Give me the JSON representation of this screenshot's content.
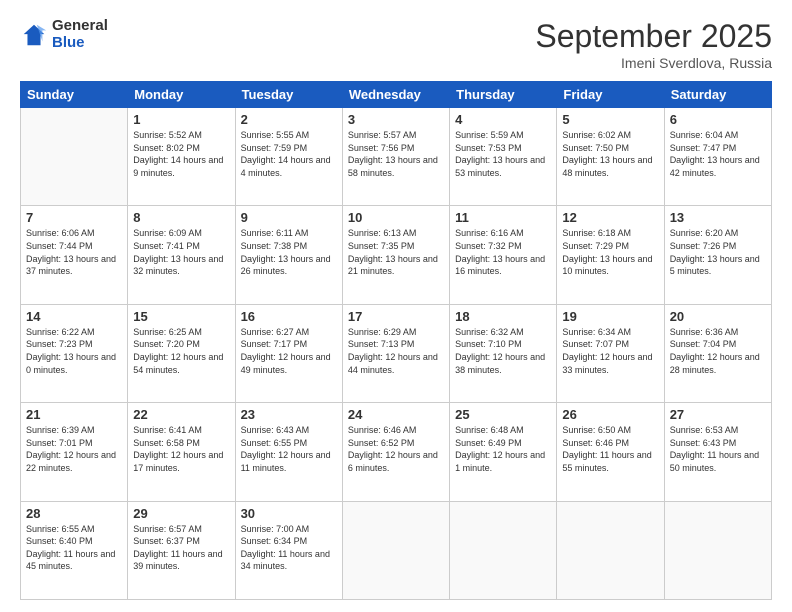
{
  "logo": {
    "line1": "General",
    "line2": "Blue"
  },
  "header": {
    "title": "September 2025",
    "subtitle": "Imeni Sverdlova, Russia"
  },
  "weekdays": [
    "Sunday",
    "Monday",
    "Tuesday",
    "Wednesday",
    "Thursday",
    "Friday",
    "Saturday"
  ],
  "weeks": [
    [
      {
        "day": "",
        "empty": true
      },
      {
        "day": "1",
        "sunrise": "5:52 AM",
        "sunset": "8:02 PM",
        "daylight": "14 hours and 9 minutes."
      },
      {
        "day": "2",
        "sunrise": "5:55 AM",
        "sunset": "7:59 PM",
        "daylight": "14 hours and 4 minutes."
      },
      {
        "day": "3",
        "sunrise": "5:57 AM",
        "sunset": "7:56 PM",
        "daylight": "13 hours and 58 minutes."
      },
      {
        "day": "4",
        "sunrise": "5:59 AM",
        "sunset": "7:53 PM",
        "daylight": "13 hours and 53 minutes."
      },
      {
        "day": "5",
        "sunrise": "6:02 AM",
        "sunset": "7:50 PM",
        "daylight": "13 hours and 48 minutes."
      },
      {
        "day": "6",
        "sunrise": "6:04 AM",
        "sunset": "7:47 PM",
        "daylight": "13 hours and 42 minutes."
      }
    ],
    [
      {
        "day": "7",
        "sunrise": "6:06 AM",
        "sunset": "7:44 PM",
        "daylight": "13 hours and 37 minutes."
      },
      {
        "day": "8",
        "sunrise": "6:09 AM",
        "sunset": "7:41 PM",
        "daylight": "13 hours and 32 minutes."
      },
      {
        "day": "9",
        "sunrise": "6:11 AM",
        "sunset": "7:38 PM",
        "daylight": "13 hours and 26 minutes."
      },
      {
        "day": "10",
        "sunrise": "6:13 AM",
        "sunset": "7:35 PM",
        "daylight": "13 hours and 21 minutes."
      },
      {
        "day": "11",
        "sunrise": "6:16 AM",
        "sunset": "7:32 PM",
        "daylight": "13 hours and 16 minutes."
      },
      {
        "day": "12",
        "sunrise": "6:18 AM",
        "sunset": "7:29 PM",
        "daylight": "13 hours and 10 minutes."
      },
      {
        "day": "13",
        "sunrise": "6:20 AM",
        "sunset": "7:26 PM",
        "daylight": "13 hours and 5 minutes."
      }
    ],
    [
      {
        "day": "14",
        "sunrise": "6:22 AM",
        "sunset": "7:23 PM",
        "daylight": "13 hours and 0 minutes."
      },
      {
        "day": "15",
        "sunrise": "6:25 AM",
        "sunset": "7:20 PM",
        "daylight": "12 hours and 54 minutes."
      },
      {
        "day": "16",
        "sunrise": "6:27 AM",
        "sunset": "7:17 PM",
        "daylight": "12 hours and 49 minutes."
      },
      {
        "day": "17",
        "sunrise": "6:29 AM",
        "sunset": "7:13 PM",
        "daylight": "12 hours and 44 minutes."
      },
      {
        "day": "18",
        "sunrise": "6:32 AM",
        "sunset": "7:10 PM",
        "daylight": "12 hours and 38 minutes."
      },
      {
        "day": "19",
        "sunrise": "6:34 AM",
        "sunset": "7:07 PM",
        "daylight": "12 hours and 33 minutes."
      },
      {
        "day": "20",
        "sunrise": "6:36 AM",
        "sunset": "7:04 PM",
        "daylight": "12 hours and 28 minutes."
      }
    ],
    [
      {
        "day": "21",
        "sunrise": "6:39 AM",
        "sunset": "7:01 PM",
        "daylight": "12 hours and 22 minutes."
      },
      {
        "day": "22",
        "sunrise": "6:41 AM",
        "sunset": "6:58 PM",
        "daylight": "12 hours and 17 minutes."
      },
      {
        "day": "23",
        "sunrise": "6:43 AM",
        "sunset": "6:55 PM",
        "daylight": "12 hours and 11 minutes."
      },
      {
        "day": "24",
        "sunrise": "6:46 AM",
        "sunset": "6:52 PM",
        "daylight": "12 hours and 6 minutes."
      },
      {
        "day": "25",
        "sunrise": "6:48 AM",
        "sunset": "6:49 PM",
        "daylight": "12 hours and 1 minute."
      },
      {
        "day": "26",
        "sunrise": "6:50 AM",
        "sunset": "6:46 PM",
        "daylight": "11 hours and 55 minutes."
      },
      {
        "day": "27",
        "sunrise": "6:53 AM",
        "sunset": "6:43 PM",
        "daylight": "11 hours and 50 minutes."
      }
    ],
    [
      {
        "day": "28",
        "sunrise": "6:55 AM",
        "sunset": "6:40 PM",
        "daylight": "11 hours and 45 minutes."
      },
      {
        "day": "29",
        "sunrise": "6:57 AM",
        "sunset": "6:37 PM",
        "daylight": "11 hours and 39 minutes."
      },
      {
        "day": "30",
        "sunrise": "7:00 AM",
        "sunset": "6:34 PM",
        "daylight": "11 hours and 34 minutes."
      },
      {
        "day": "",
        "empty": true
      },
      {
        "day": "",
        "empty": true
      },
      {
        "day": "",
        "empty": true
      },
      {
        "day": "",
        "empty": true
      }
    ]
  ]
}
